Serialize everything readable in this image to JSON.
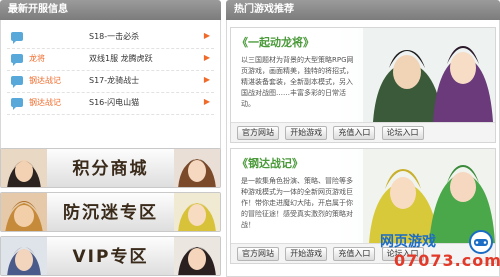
{
  "latest_servers": {
    "title": "最新开服信息",
    "rows": [
      {
        "game": "",
        "server": "S18-一击必杀"
      },
      {
        "game": "龙将",
        "server": "双线1服 龙腾虎跃"
      },
      {
        "game": "钢达战记",
        "server": "S17-龙骑战士"
      },
      {
        "game": "钢达战记",
        "server": "S16-闪电山猫"
      }
    ]
  },
  "banners": [
    {
      "label": "积分商城"
    },
    {
      "label": "防沉迷专区"
    },
    {
      "label": "VIP专区"
    }
  ],
  "recommend": {
    "title": "热门游戏推荐",
    "cards": [
      {
        "title": "《一起动龙将》",
        "desc": "以三国题材为背景的大型策略RPG网页游戏，画面精美，独特的将招式，精湛装备套装，全新副本模式，另入国战对战图……丰富多彩的日常活动。",
        "buttons": [
          "官方网站",
          "开始游戏",
          "充值入口",
          "论坛入口"
        ]
      },
      {
        "title": "《钢达战记》",
        "desc": "是一款集角色扮演、策略、冒险等多种游戏模式为一体的全新网页游戏巨作！带你走进魔幻大陆，开启属于你的冒险征途！感受真实激烈的策略对战！",
        "buttons": [
          "官方网站",
          "开始游戏",
          "充值入口",
          "论坛入口"
        ]
      }
    ]
  },
  "watermark": {
    "text": "网页游戏",
    "url": "07073.com"
  }
}
